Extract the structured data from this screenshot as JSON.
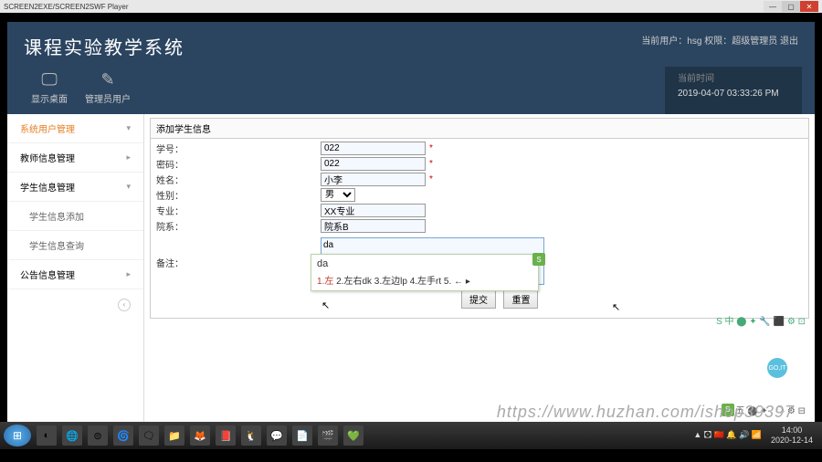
{
  "window": {
    "title": "SCREEN2EXE/SCREEN2SWF Player",
    "min": "—",
    "max": "▢",
    "close": "✕"
  },
  "brand": "课程实验教学系统",
  "user_info": "当前用户：hsg 权限：超级管理员 退出",
  "toolbar": {
    "desktop": {
      "icon": "🖵",
      "label": "显示桌面"
    },
    "users": {
      "icon": "✎",
      "label": "管理员用户"
    }
  },
  "clock": {
    "label": "当前时间",
    "value": "2019-04-07 03:33:26 PM"
  },
  "sidebar": {
    "items": [
      {
        "label": "系统用户管理",
        "active": true,
        "chev": "▾"
      },
      {
        "label": "教师信息管理",
        "chev": "▸"
      },
      {
        "label": "学生信息管理",
        "chev": "▾"
      },
      {
        "label": "学生信息添加",
        "sub": true
      },
      {
        "label": "学生信息查询",
        "sub": true
      },
      {
        "label": "公告信息管理",
        "chev": "▸"
      }
    ],
    "pager": "‹"
  },
  "panel": {
    "title": "添加学生信息"
  },
  "form": {
    "rows": [
      {
        "label": "学号：",
        "value": "022",
        "req": "*"
      },
      {
        "label": "密码：",
        "value": "022",
        "req": "*"
      },
      {
        "label": "姓名：",
        "value": "小李",
        "req": "*"
      },
      {
        "label": "性别：",
        "value": "男",
        "select": true
      },
      {
        "label": "专业：",
        "value": "XX专业"
      },
      {
        "label": "院系：",
        "value": "院系B"
      },
      {
        "label": "备注：",
        "value": "da",
        "textarea": true
      }
    ],
    "submit": "提交",
    "reset": "重置"
  },
  "ime": {
    "typed": "da",
    "badge": "S",
    "candidates": "1.左  2.左右dk  3.左边lp  4.左手rt  5. ← ▸"
  },
  "ime_status": {
    "badge": "S",
    "text": "五 ⬤ ✦ , ☁ ⚙ ⊟"
  },
  "tray": "S 中 ⬤ ✦ 🔧 ⬛ ⚙ ⊡",
  "float_badge": "GO,IT",
  "watermark": "https://www.huzhan.com/ishop39397",
  "taskbar": {
    "icons": [
      "◐",
      "🌐",
      "⊜",
      "🌀",
      "🗨",
      "📁",
      "🦊",
      "📕",
      "🐧",
      "💬",
      "📄",
      "🎬",
      "💚"
    ],
    "right_icons": "▲ 🖸 🇨🇳 🔔 🔊 📶",
    "time": "14:00",
    "date": "2020-12-14"
  }
}
